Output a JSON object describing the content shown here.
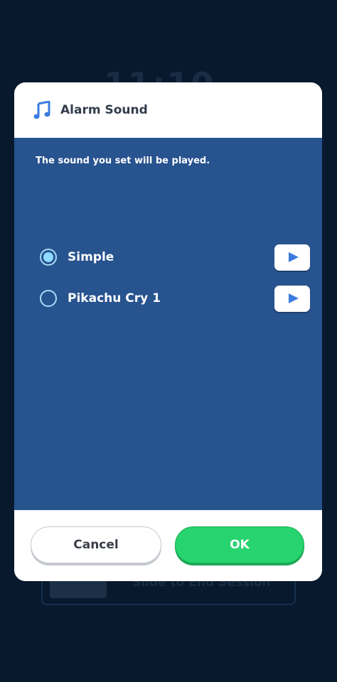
{
  "background": {
    "time": "11:10",
    "slider_label": "Slide to End Session"
  },
  "dialog": {
    "icon": "music-note-icon",
    "title": "Alarm Sound",
    "subtitle": "The sound you set will be played.",
    "options": [
      {
        "label": "Simple",
        "selected": true
      },
      {
        "label": "Pikachu Cry 1",
        "selected": false
      }
    ],
    "cancel_label": "Cancel",
    "ok_label": "OK"
  },
  "colors": {
    "accent_blue": "#3b7be0",
    "body_blue": "#27538f",
    "ok_green": "#27d46f"
  }
}
